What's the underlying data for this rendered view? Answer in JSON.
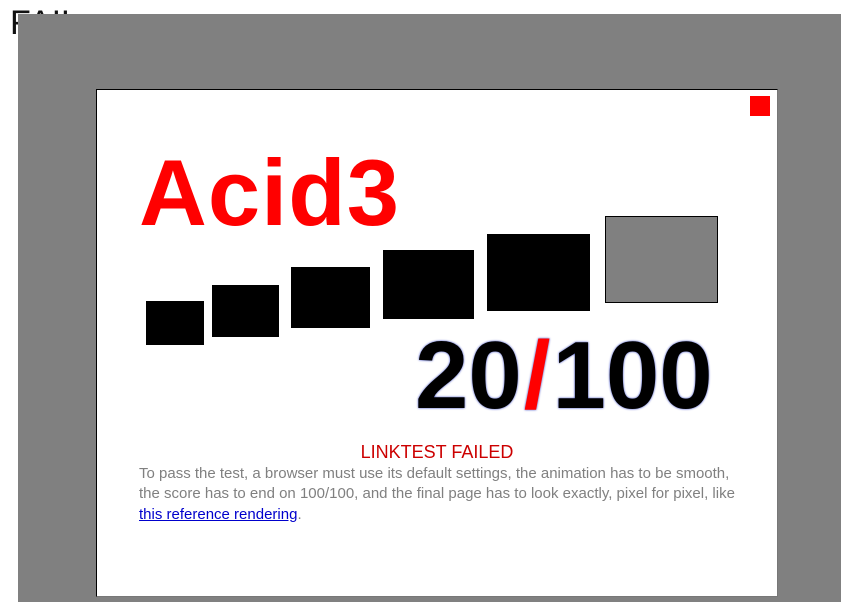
{
  "status_banner": "FAIL",
  "test": {
    "title": "Acid3",
    "score": "20",
    "score_separator": "/",
    "score_max": "100",
    "result_message": "LINKTEST FAILED",
    "instructions_before_link": "To pass the test, a browser must use its default settings, the animation has to be smooth, the score has to end on 100/100, and the final page has to look exactly, pixel for pixel, like",
    "reference_link_label": "this reference rendering",
    "instructions_after_link": "."
  },
  "colors": {
    "title": "#ff0000",
    "slash": "#ff0000",
    "indicator": "#ff0000",
    "passed_bucket": "#000000",
    "pending_bucket": "#808080",
    "frame": "#808080"
  }
}
